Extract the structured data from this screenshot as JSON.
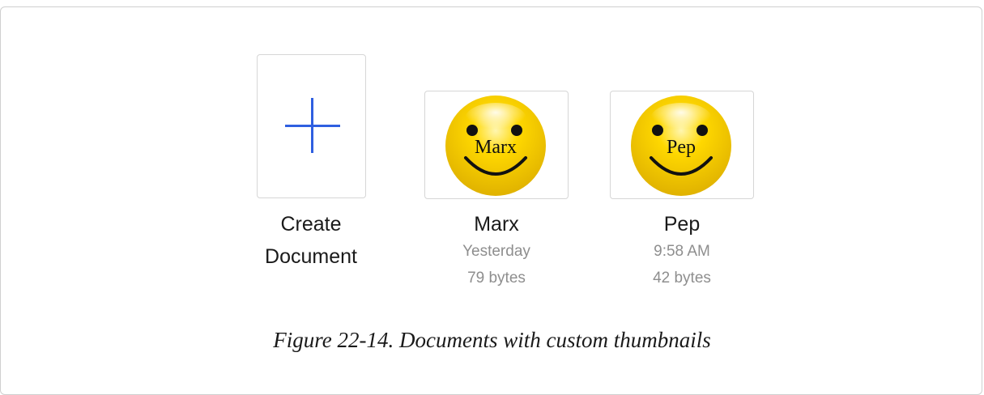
{
  "create": {
    "label_line1": "Create",
    "label_line2": "Document",
    "icon": "plus-icon",
    "accent": "#2f5fe0"
  },
  "documents": [
    {
      "name": "Marx",
      "thumbnail_text": "Marx",
      "modified": "Yesterday",
      "size": "79 bytes",
      "icon": "smiley-face-icon"
    },
    {
      "name": "Pep",
      "thumbnail_text": "Pep",
      "modified": "9:58 AM",
      "size": "42 bytes",
      "icon": "smiley-face-icon"
    }
  ],
  "caption": "Figure 22-14. Documents with custom thumbnails",
  "colors": {
    "smiley_yellow": "#f5cc00",
    "meta_gray": "#8e8e8e"
  }
}
